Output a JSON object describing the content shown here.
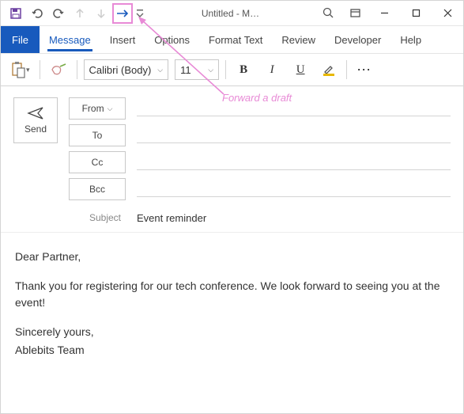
{
  "titlebar": {
    "title": "Untitled  -  M…"
  },
  "tabs": {
    "file": "File",
    "items": [
      "Message",
      "Insert",
      "Options",
      "Format Text",
      "Review",
      "Developer",
      "Help"
    ],
    "active": 0
  },
  "ribbon": {
    "font": "Calibri (Body)",
    "size": "11",
    "bold": "B",
    "italic": "I",
    "underline": "U",
    "more": "⋯"
  },
  "compose": {
    "send": "Send",
    "from": "From",
    "to": "To",
    "cc": "Cc",
    "bcc": "Bcc",
    "subject_label": "Subject",
    "subject_value": "Event reminder"
  },
  "body": {
    "greeting": "Dear Partner,",
    "para1": "Thank you for registering for our tech conference. We look forward to seeing you at the event!",
    "signoff": "Sincerely yours,",
    "signature": "Ablebits Team"
  },
  "annotation": {
    "text": "Forward a draft"
  }
}
